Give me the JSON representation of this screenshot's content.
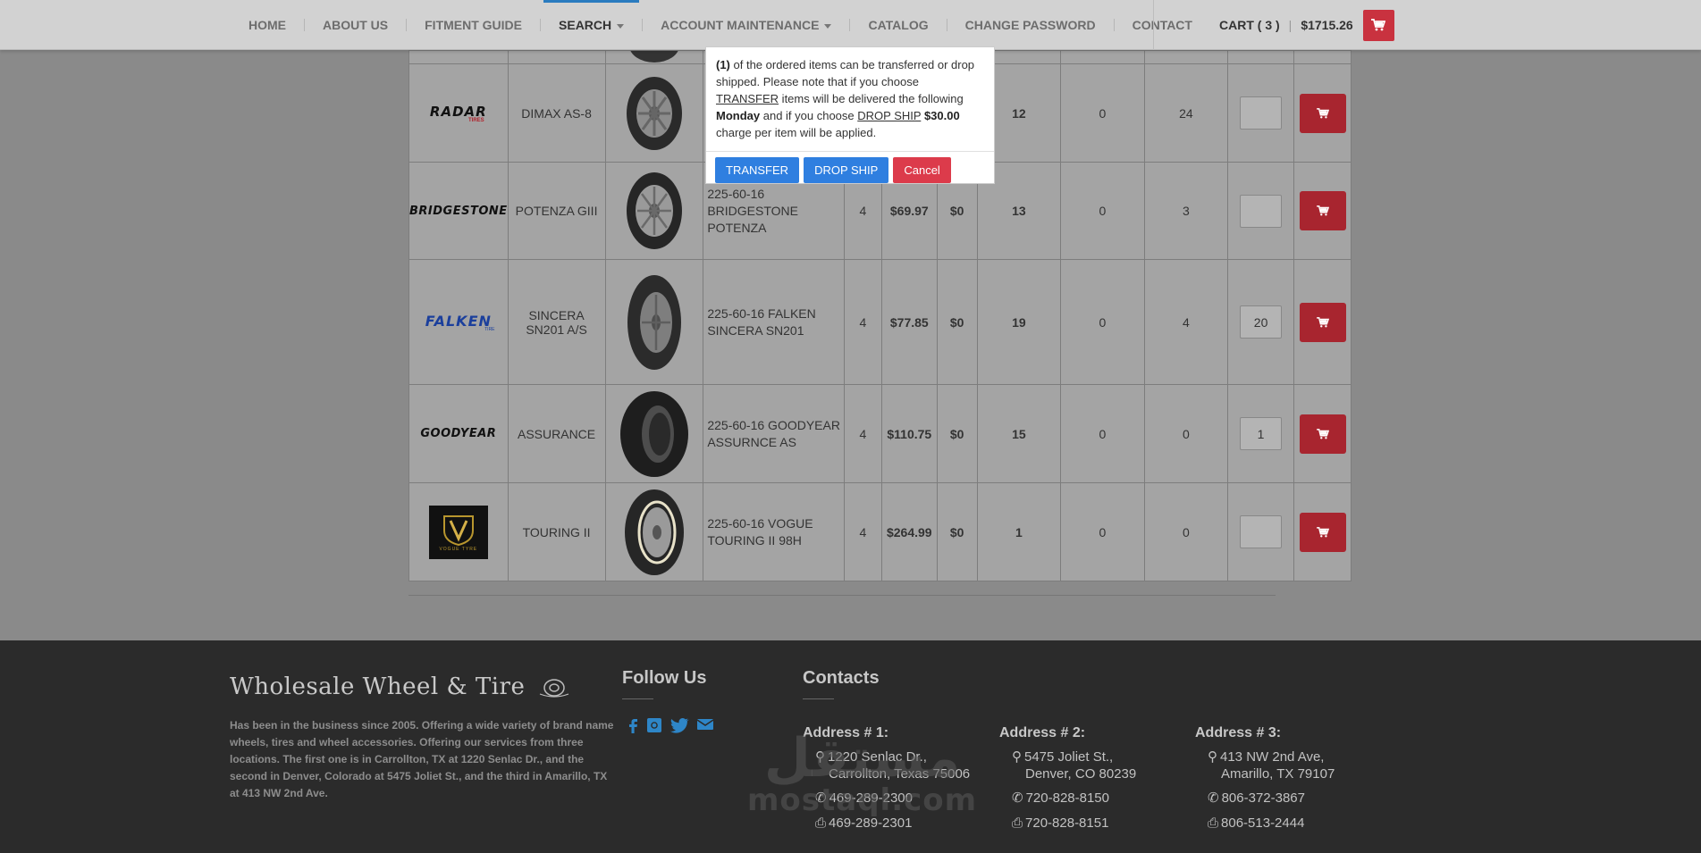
{
  "nav": {
    "items": [
      {
        "label": "HOME"
      },
      {
        "label": "ABOUT US"
      },
      {
        "label": "FITMENT GUIDE"
      },
      {
        "label": "SEARCH",
        "active": true,
        "dropdown": true
      },
      {
        "label": "ACCOUNT MAINTENANCE",
        "dropdown": true
      },
      {
        "label": "CATALOG"
      },
      {
        "label": "CHANGE PASSWORD"
      },
      {
        "label": "CONTACT"
      }
    ],
    "cart_label": "CART ( 3 )",
    "cart_total": "$1715.26",
    "cart_icon": "shopping-cart-icon"
  },
  "table": {
    "rows": [
      {
        "brand": "RADAR",
        "brand_sub": "TIRES",
        "model": "DIMAX AS-8",
        "description": "",
        "qty": "",
        "price": "",
        "fee": "",
        "stock1": "12",
        "stock2": "0",
        "stock3": "24",
        "order_qty": ""
      },
      {
        "brand": "BRIDGESTONE",
        "brand_sub": "",
        "model": "POTENZA GIII",
        "description": "225-60-16 BRIDGESTONE POTENZA",
        "qty": "4",
        "price": "$69.97",
        "fee": "$0",
        "stock1": "13",
        "stock2": "0",
        "stock3": "3",
        "order_qty": ""
      },
      {
        "brand": "FALKEN",
        "brand_sub": "TIRE",
        "model": "SINCERA SN201 A/S",
        "description": "225-60-16 FALKEN SINCERA SN201",
        "qty": "4",
        "price": "$77.85",
        "fee": "$0",
        "stock1": "19",
        "stock2": "0",
        "stock3": "4",
        "order_qty": "20"
      },
      {
        "brand": "GOODYEAR",
        "brand_sub": "",
        "model": "ASSURANCE",
        "description": "225-60-16 GOODYEAR ASSURNCE AS",
        "qty": "4",
        "price": "$110.75",
        "fee": "$0",
        "stock1": "15",
        "stock2": "0",
        "stock3": "0",
        "order_qty": "1"
      },
      {
        "brand": "VOGUE TYRE",
        "brand_sub": "",
        "model": "TOURING II",
        "description": "225-60-16 VOGUE TOURING II 98H",
        "qty": "4",
        "price": "$264.99",
        "fee": "$0",
        "stock1": "1",
        "stock2": "0",
        "stock3": "0",
        "order_qty": ""
      }
    ]
  },
  "modal": {
    "count": "(1)",
    "text1": " of the ordered items can be transferred or drop shipped. Please note that if you choose ",
    "transfer_word": "TRANSFER",
    "text2": " items will be delivered the following ",
    "day": "Monday",
    "text3": " and if you choose ",
    "dropship_word": "DROP SHIP",
    "fee": "$30.00",
    "text4": " charge per item will be applied.",
    "buttons": {
      "transfer": "TRANSFER",
      "dropship": "DROP SHIP",
      "cancel": "Cancel"
    }
  },
  "footer": {
    "logo": "Wholesale Wheel & Tire",
    "about": "Has been in the business since 2005. Offering a wide variety of brand name wheels, tires and wheel accessories. Offering our services from three locations. The first one is in Carrollton, TX at 1220 Senlac Dr., and the second in Denver, Colorado at 5475 Joliet St., and the third in Amarillo, TX at 413 NW 2nd Ave.",
    "follow_heading": "Follow Us",
    "contacts_heading": "Contacts",
    "social_icons": [
      "facebook-icon",
      "instagram-icon",
      "twitter-icon",
      "email-icon"
    ],
    "addresses": [
      {
        "title": "Address # 1:",
        "line1": "1220 Senlac Dr.,",
        "line2": "Carrollton, Texas 75006",
        "phone": "469-289-2300",
        "fax": "469-289-2301"
      },
      {
        "title": "Address # 2:",
        "line1": "5475 Joliet St.,",
        "line2": "Denver, CO 80239",
        "phone": "720-828-8150",
        "fax": "720-828-8151"
      },
      {
        "title": "Address # 3:",
        "line1": "413 NW 2nd Ave,",
        "line2": "Amarillo, TX 79107",
        "phone": "806-372-3867",
        "fax": "806-513-2444"
      }
    ],
    "watermark_ar": "مستقل",
    "watermark_en": "mostaql.com"
  },
  "colors": {
    "nav_bg": "#d2d2d2",
    "accent_red": "#c9323f",
    "accent_blue": "#2f7fe0",
    "cancel_red": "#dc3b4b",
    "footer_bg": "#2b2b2b",
    "social_blue": "#2e86c8"
  }
}
